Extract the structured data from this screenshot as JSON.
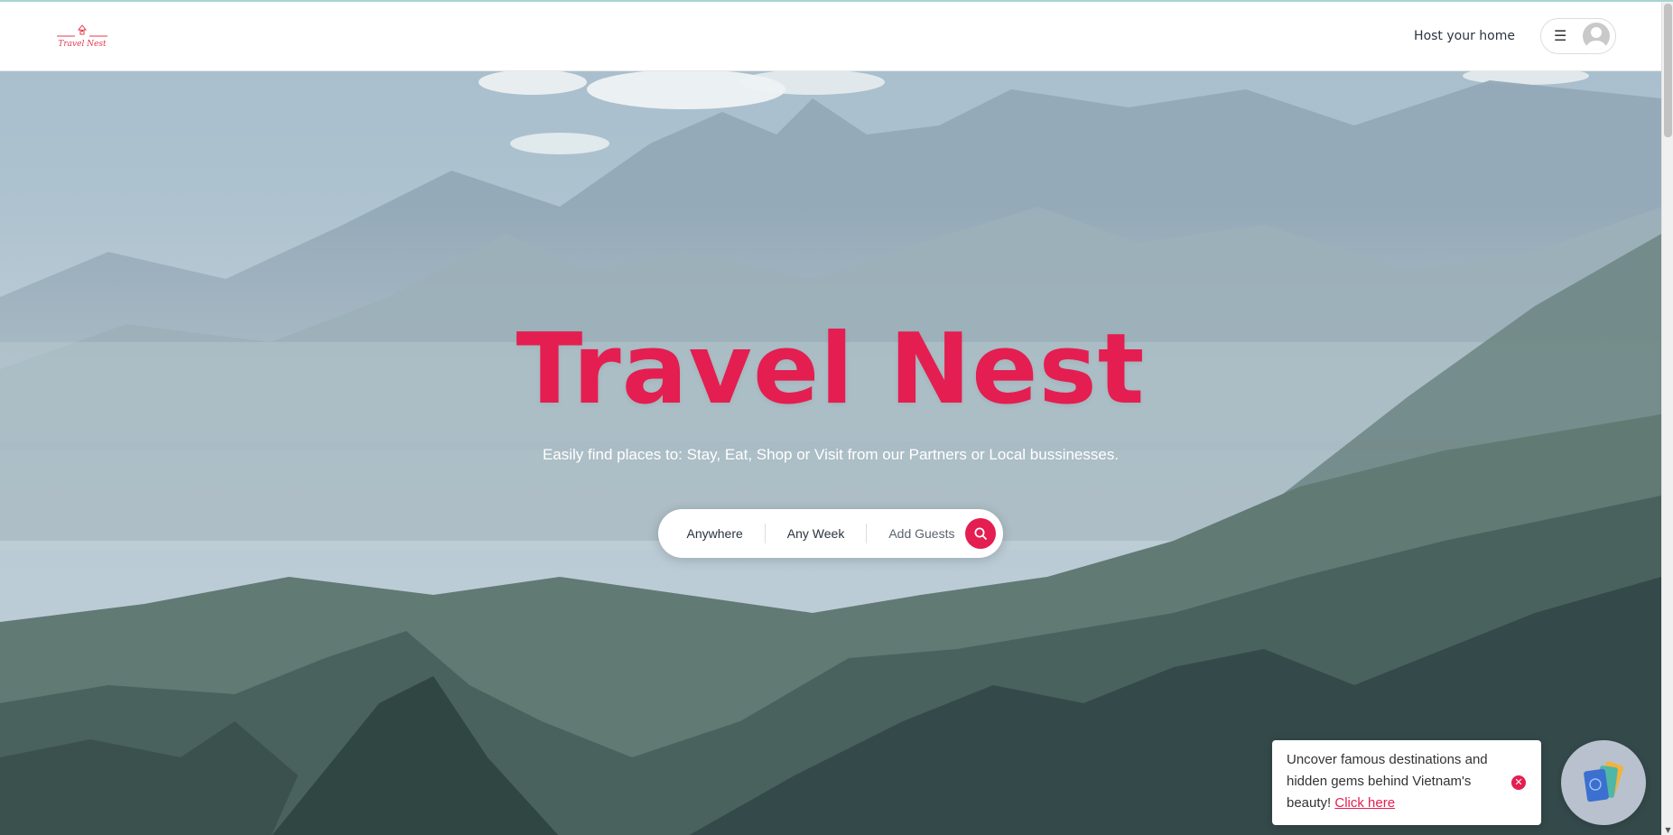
{
  "header": {
    "logo_text": "Travel Nest",
    "host_link": "Host your home",
    "menu_icon": "hamburger-icon",
    "avatar_icon": "user-avatar-icon"
  },
  "hero": {
    "title": "Travel Nest",
    "subtitle": "Easily find places to: Stay, Eat, Shop or Visit from our Partners or Local bussinesses.",
    "search": {
      "location": "Anywhere",
      "dates": "Any Week",
      "guests": "Add Guests",
      "button_icon": "search-icon"
    }
  },
  "toast": {
    "message": "Uncover famous destinations and hidden gems behind Vietnam's beauty!",
    "link_text": "Click here",
    "close_icon": "close-icon"
  },
  "chat": {
    "icon": "passport-tickets-icon"
  },
  "colors": {
    "brand": "#e41e50",
    "header_bg": "#ffffff",
    "text": "#2b3440"
  }
}
